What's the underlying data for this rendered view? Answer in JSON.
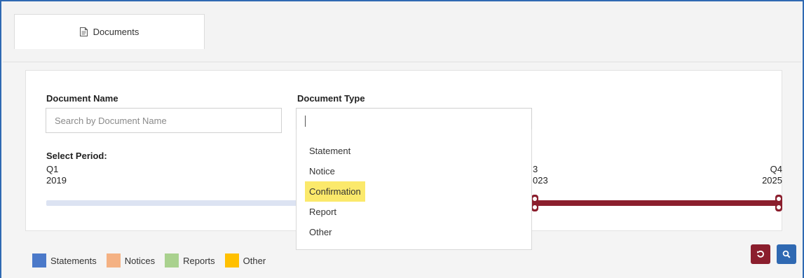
{
  "tabs": [
    {
      "label": "Documents"
    }
  ],
  "form": {
    "document_name": {
      "label": "Document Name",
      "placeholder": "Search by Document Name",
      "value": ""
    },
    "document_type": {
      "label": "Document Type",
      "value": "",
      "options": [
        "Statement",
        "Notice",
        "Confirmation",
        "Report",
        "Other"
      ],
      "highlighted": "Confirmation"
    }
  },
  "period": {
    "label": "Select Period:",
    "start": {
      "quarter": "Q1",
      "year": "2019"
    },
    "partial_left": {
      "quarter": "3",
      "year": "023"
    },
    "end": {
      "quarter": "Q4",
      "year": "2025"
    }
  },
  "legend": [
    {
      "label": "Statements",
      "color": "#4b79c9"
    },
    {
      "label": "Notices",
      "color": "#f4b183"
    },
    {
      "label": "Reports",
      "color": "#a9d18e"
    },
    {
      "label": "Other",
      "color": "#ffc000"
    }
  ],
  "buttons": {
    "reset": {
      "icon": "reset-icon",
      "color": "#8b1e2d"
    },
    "search": {
      "icon": "search-icon",
      "color": "#2f69b2"
    }
  },
  "colors": {
    "range_active": "#8b1e2d",
    "range_inactive": "#dce3f2",
    "highlight": "#fbe96b"
  }
}
